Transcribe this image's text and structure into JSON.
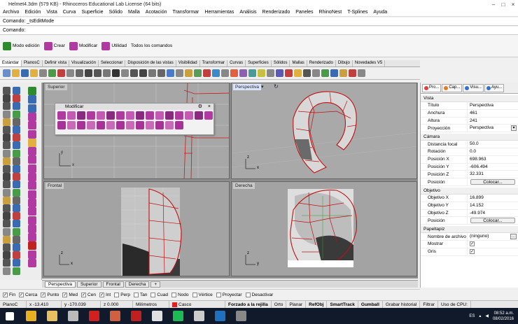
{
  "window": {
    "title": "Helmet4.3dm (579 KB) - Rhinoceros Educational Lab License (64 bits)"
  },
  "menu": [
    "Archivo",
    "Edición",
    "Vista",
    "Curva",
    "Superficie",
    "Sólido",
    "Malla",
    "Acotación",
    "Transformar",
    "Herramientas",
    "Análisis",
    "Renderizado",
    "Paneles",
    "RhinoNest",
    "T-Splines",
    "Ayuda"
  ],
  "command_history": "Comando: _tsEditMode",
  "command_prompt": "Comando:",
  "modes": [
    {
      "label": "Modo edición",
      "icon": "power-icon",
      "color": "#2e8b2e"
    },
    {
      "label": "Crear",
      "icon": "create-icon",
      "color": "#b03aa0"
    },
    {
      "label": "Modificar",
      "icon": "modify-icon",
      "color": "#b03aa0"
    },
    {
      "label": "Utilidad",
      "icon": "utility-icon",
      "color": "#b03aa0"
    },
    {
      "label": "Todos los comandos",
      "icon": "",
      "color": ""
    }
  ],
  "toolbar_tabs": [
    "Estándar",
    "PlanosC",
    "Definir vista",
    "Visualización",
    "Seleccionar",
    "Disposición de las vistas",
    "Visibilidad",
    "Transformar",
    "Curvas",
    "Superficies",
    "Sólidos",
    "Mallas",
    "Renderizado",
    "Dibujo",
    "Novedades V5"
  ],
  "viewports": [
    {
      "name": "Superior",
      "active": false
    },
    {
      "name": "Perspectiva",
      "active": true
    },
    {
      "name": "Frontal",
      "active": false
    },
    {
      "name": "Derecha",
      "active": false
    }
  ],
  "axis_labels": {
    "x": "x",
    "y": "y",
    "z": "z"
  },
  "floating_toolbar": {
    "title": "Modificar"
  },
  "viewport_tabs": [
    "Perspectiva",
    "Superior",
    "Frontal",
    "Derecha"
  ],
  "viewport_tab_add": "+",
  "panel_tabs": [
    {
      "label": "Pro...",
      "color": "#e04040"
    },
    {
      "label": "Cap...",
      "color": "#e08020"
    },
    {
      "label": "Visu...",
      "color": "#3070d0"
    },
    {
      "label": "Ayu...",
      "color": "#3070d0"
    }
  ],
  "properties": {
    "vista": {
      "header": "Vista",
      "rows": [
        {
          "label": "Título",
          "value": "Perspectiva"
        },
        {
          "label": "Anchura",
          "value": "461"
        },
        {
          "label": "Altura",
          "value": "241"
        },
        {
          "label": "Proyección",
          "value": "Perspectiva"
        }
      ]
    },
    "camara": {
      "header": "Cámara",
      "rows": [
        {
          "label": "Distancia focal",
          "value": "50.0"
        },
        {
          "label": "Rotación",
          "value": "0.0"
        },
        {
          "label": "Posición X",
          "value": "698.963"
        },
        {
          "label": "Posición Y",
          "value": "-606.494"
        },
        {
          "label": "Posición Z",
          "value": "32.331"
        },
        {
          "label": "Posición",
          "value": "Colocar..."
        }
      ]
    },
    "objetivo": {
      "header": "Objetivo",
      "rows": [
        {
          "label": "Objetivo X",
          "value": "16.899"
        },
        {
          "label": "Objetivo Y",
          "value": "14.152"
        },
        {
          "label": "Objetivo Z",
          "value": "-49.974"
        },
        {
          "label": "Posición",
          "value": "Colocar..."
        }
      ]
    },
    "papeltapiz": {
      "header": "Papeltapiz",
      "rows": [
        {
          "label": "Nombre de archivo",
          "value": "(ninguno)"
        },
        {
          "label": "Mostrar",
          "value": "✓"
        },
        {
          "label": "Gris",
          "value": "✓"
        }
      ]
    }
  },
  "osnaps": [
    {
      "label": "Fin",
      "checked": true
    },
    {
      "label": "Cerca",
      "checked": true
    },
    {
      "label": "Punto",
      "checked": true
    },
    {
      "label": "Med",
      "checked": true
    },
    {
      "label": "Cen",
      "checked": true
    },
    {
      "label": "Int",
      "checked": true
    },
    {
      "label": "Perp",
      "checked": false
    },
    {
      "label": "Tan",
      "checked": false
    },
    {
      "label": "Cuad",
      "checked": false
    },
    {
      "label": "Nodo",
      "checked": false
    },
    {
      "label": "Vértice",
      "checked": false
    },
    {
      "label": "Proyectar",
      "checked": false
    },
    {
      "label": "Desactivar",
      "checked": false
    }
  ],
  "status": {
    "plane": "PlanoC",
    "x": "x -13.410",
    "y": "y -170.039",
    "z": "z 0.000",
    "units": "Milímetros",
    "layer": "Casco",
    "layer_color": "#e02020",
    "toggles": [
      "Forzado a la rejilla",
      "Orto",
      "Planar",
      "RefObj",
      "SmartTrack",
      "Gumball",
      "Grabar historial",
      "Filtrar",
      "Uso de CPU:"
    ]
  },
  "taskbar": {
    "apps": [
      {
        "name": "windows-start-icon",
        "color": "#ffffff"
      },
      {
        "name": "chrome-icon",
        "color": "#e8b020"
      },
      {
        "name": "explorer-icon",
        "color": "#e8c060"
      },
      {
        "name": "rhino-icon",
        "color": "#bbbbbb"
      },
      {
        "name": "acrobat-icon",
        "color": "#d02020"
      },
      {
        "name": "sketchup-icon",
        "color": "#d06040"
      },
      {
        "name": "autocad-icon",
        "color": "#c02020"
      },
      {
        "name": "itunes-icon",
        "color": "#e0e0e0"
      },
      {
        "name": "spotify-icon",
        "color": "#1db954"
      },
      {
        "name": "rhino-icon-2",
        "color": "#cccccc"
      },
      {
        "name": "photoshop-icon",
        "color": "#2070c0"
      },
      {
        "name": "app-icon",
        "color": "#888888"
      }
    ],
    "lang": "ES",
    "time": "08:52 a.m.",
    "date": "08/02/2016"
  }
}
